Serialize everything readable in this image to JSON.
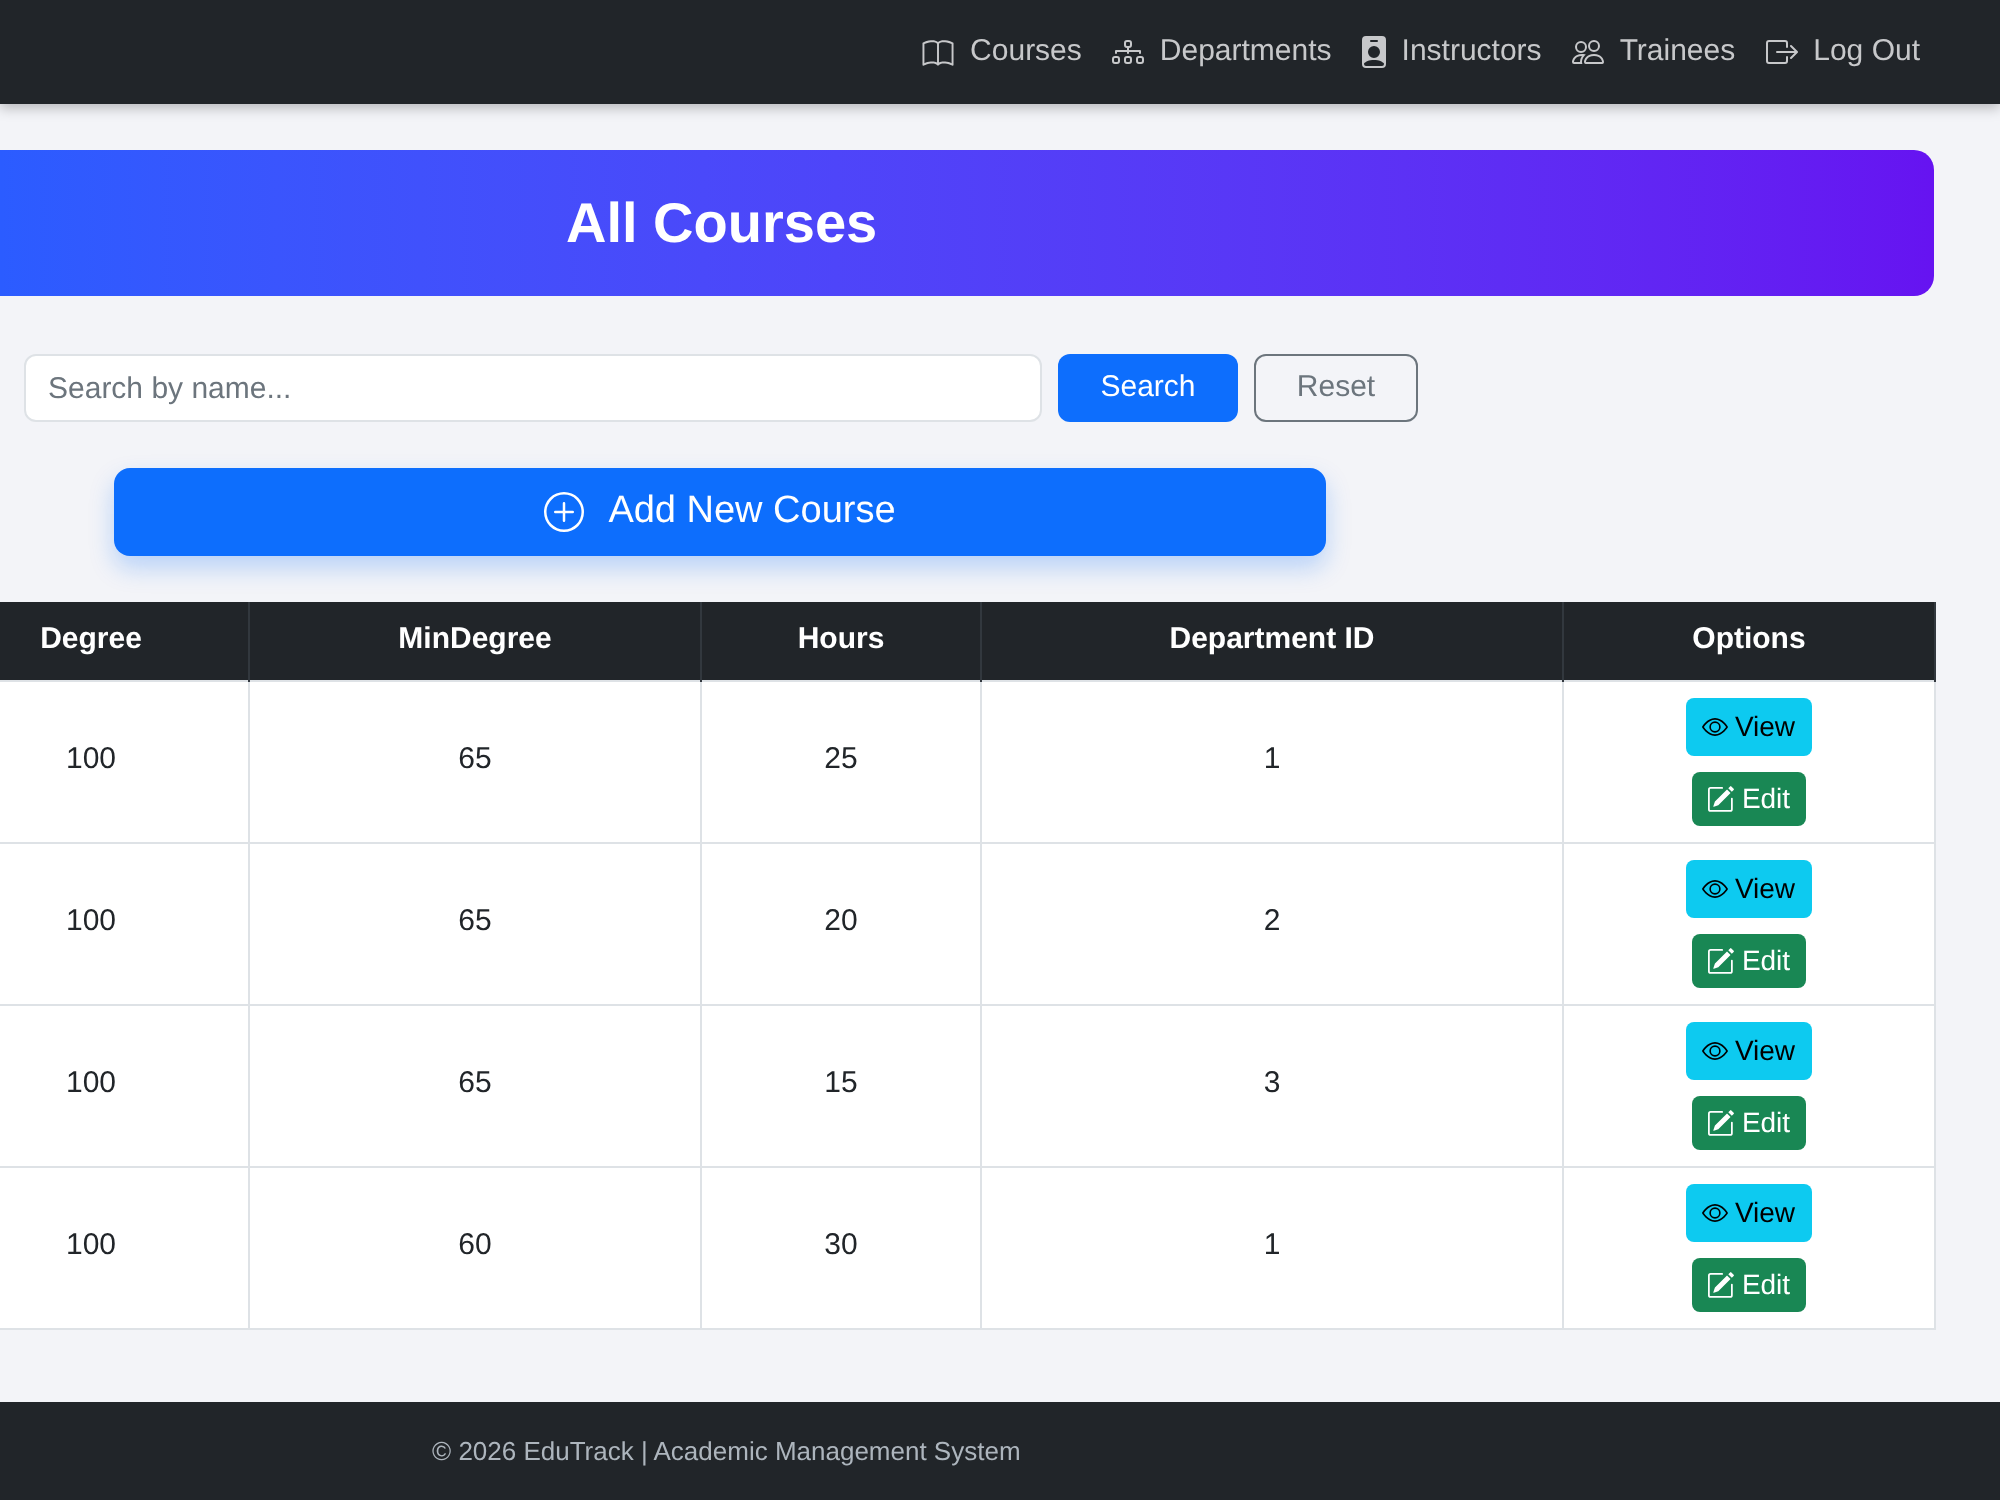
{
  "navbar": {
    "links": [
      {
        "label": "Courses"
      },
      {
        "label": "Departments"
      },
      {
        "label": "Instructors"
      },
      {
        "label": "Trainees"
      },
      {
        "label": "Log Out"
      }
    ]
  },
  "banner": {
    "title": "All Courses"
  },
  "search": {
    "placeholder": "Search by name...",
    "buttons": [
      {
        "label": "Search",
        "kind": "primary"
      },
      {
        "label": "Reset",
        "kind": "outline"
      }
    ]
  },
  "add_button": {
    "label": "Add New Course"
  },
  "table": {
    "columns": [
      "Degree",
      "MinDegree",
      "Hours",
      "Department ID",
      "Options"
    ],
    "rows": [
      {
        "cells": [
          "100",
          "65",
          "25",
          "1"
        ],
        "actions": [
          {
            "label": "View",
            "kind": "view"
          },
          {
            "label": "Edit",
            "kind": "edit"
          }
        ]
      },
      {
        "cells": [
          "100",
          "65",
          "20",
          "2"
        ],
        "actions": [
          {
            "label": "View",
            "kind": "view"
          },
          {
            "label": "Edit",
            "kind": "edit"
          }
        ]
      },
      {
        "cells": [
          "100",
          "65",
          "15",
          "3"
        ],
        "actions": [
          {
            "label": "View",
            "kind": "view"
          },
          {
            "label": "Edit",
            "kind": "edit"
          }
        ]
      },
      {
        "cells": [
          "100",
          "60",
          "30",
          "1"
        ],
        "actions": [
          {
            "label": "View",
            "kind": "view"
          },
          {
            "label": "Edit",
            "kind": "edit"
          }
        ]
      }
    ]
  },
  "footer": {
    "text": "© 2026 EduTrack | Academic Management System"
  }
}
